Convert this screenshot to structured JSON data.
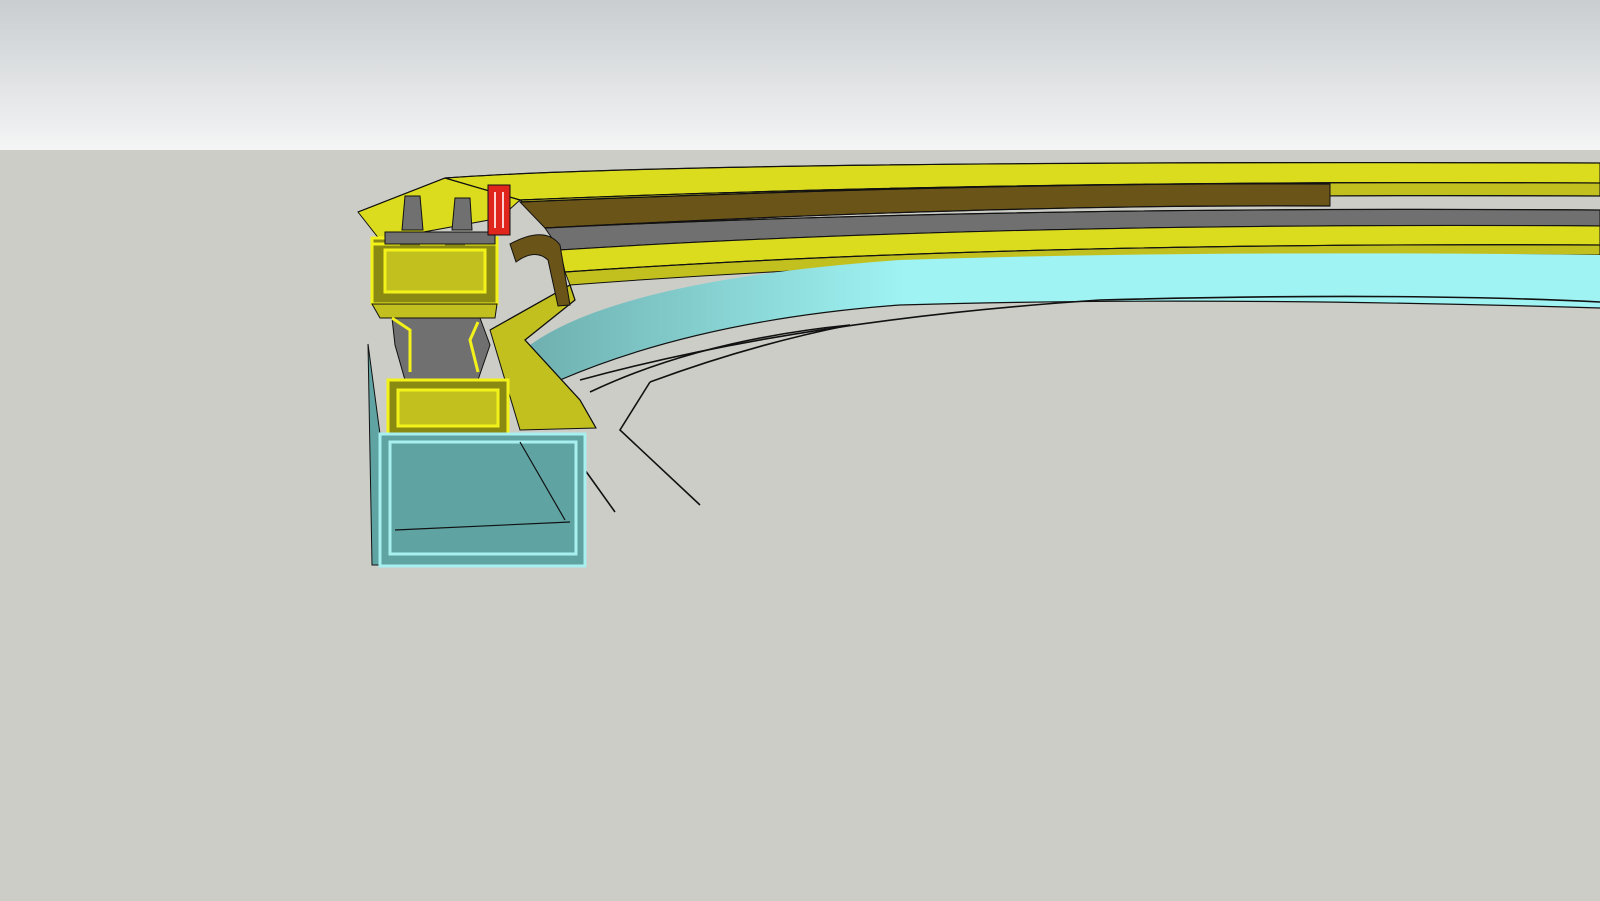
{
  "viewport": {
    "view": "3d-model-viewport",
    "sky_top_color": "#c9cdd0",
    "sky_bottom_color": "#f4f5f5",
    "ground_color": "#cdcdc8"
  },
  "model": {
    "section_fill_aluminium": "#8a8a13",
    "section_outline_aluminium": "#f2f21a",
    "profile_face_color": "#c2c01e",
    "profile_top_color": "#dcdc1e",
    "glass_color": "#9ff3f3",
    "glass_shadow_color": "#6fb0b0",
    "steel_tube_color": "#5fa3a3",
    "steel_tube_outline": "#a8f0f0",
    "gasket_color": "#707070",
    "seal_color": "#e0251c",
    "timber_trim_color": "#6b5418",
    "edge_line_color": "#111111"
  }
}
